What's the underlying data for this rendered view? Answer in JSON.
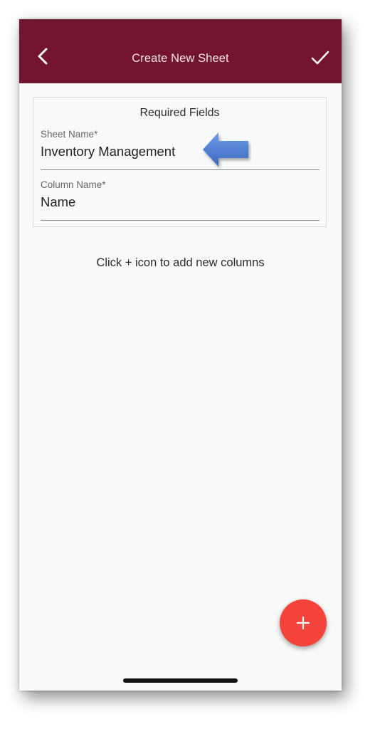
{
  "colors": {
    "appbar": "#73152f",
    "fab": "#f4433a",
    "arrow": "#4a7dd0"
  },
  "header": {
    "title": "Create New Sheet",
    "back_icon": "chevron-left-icon",
    "confirm_icon": "check-icon"
  },
  "required_card": {
    "title": "Required Fields",
    "sheet_name": {
      "label": "Sheet Name*",
      "value": "Inventory Management"
    },
    "column_name": {
      "label": "Column Name*",
      "value": "Name"
    }
  },
  "hint": "Click + icon to add new columns",
  "fab": {
    "icon": "plus-icon"
  }
}
